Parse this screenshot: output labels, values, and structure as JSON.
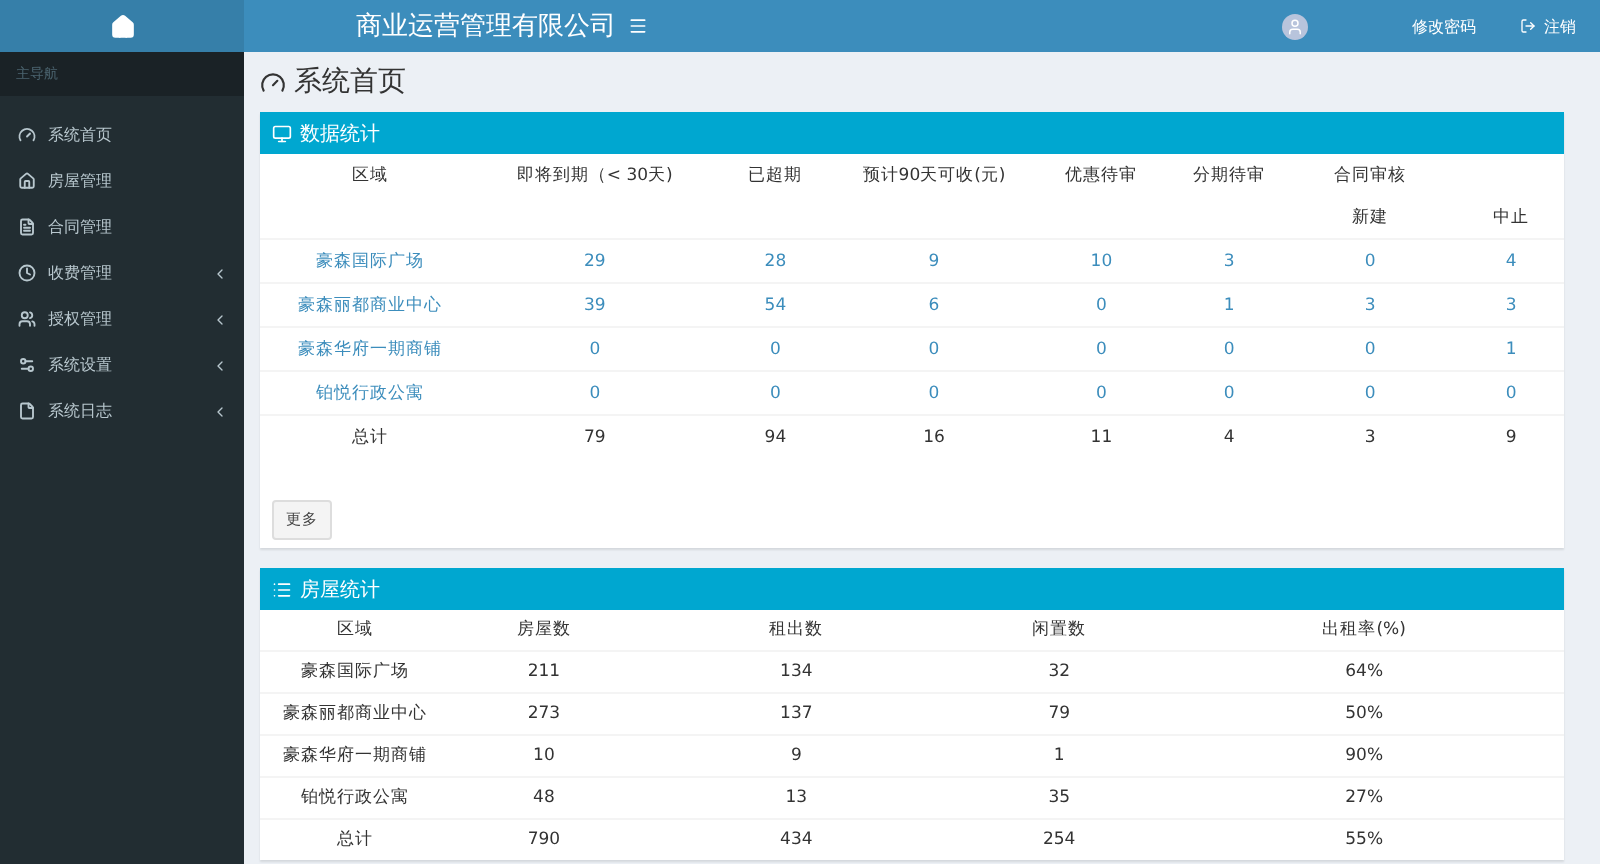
{
  "header": {
    "title": "商业运营管理有限公司",
    "password_link": "修改密码",
    "logout_link": "注销"
  },
  "sidebar": {
    "section": "主导航",
    "items": [
      {
        "label": "系统首页",
        "has_submenu": false
      },
      {
        "label": "房屋管理",
        "has_submenu": false
      },
      {
        "label": "合同管理",
        "has_submenu": false
      },
      {
        "label": "收费管理",
        "has_submenu": true
      },
      {
        "label": "授权管理",
        "has_submenu": true
      },
      {
        "label": "系统设置",
        "has_submenu": true
      },
      {
        "label": "系统日志",
        "has_submenu": true
      }
    ]
  },
  "page_title": "系统首页",
  "data_panel": {
    "title": "数据统计",
    "columns": [
      "区域",
      "即将到期（< 30天)",
      "已超期",
      "预计90天可收(元)",
      "优惠待审",
      "分期待审",
      "合同审核",
      ""
    ],
    "subcolumns": [
      "",
      "",
      "",
      "",
      "",
      "",
      "新建",
      "中止"
    ],
    "rows": [
      {
        "kind": "link",
        "cells": [
          "豪森国际广场",
          "29",
          "28",
          "9",
          "10",
          "3",
          "0",
          "4"
        ]
      },
      {
        "kind": "link",
        "cells": [
          "豪森丽都商业中心",
          "39",
          "54",
          "6",
          "0",
          "1",
          "3",
          "3"
        ]
      },
      {
        "kind": "link",
        "cells": [
          "豪森华府一期商铺",
          "0",
          "0",
          "0",
          "0",
          "0",
          "0",
          "1"
        ]
      },
      {
        "kind": "link",
        "cells": [
          "铂悦行政公寓",
          "0",
          "0",
          "0",
          "0",
          "0",
          "0",
          "0"
        ]
      },
      {
        "kind": "total",
        "cells": [
          "总计",
          "79",
          "94",
          "16",
          "11",
          "4",
          "3",
          "9"
        ]
      }
    ],
    "more_button": "更多"
  },
  "house_panel": {
    "title": "房屋统计",
    "columns": [
      "区域",
      "房屋数",
      "租出数",
      "闲置数",
      "出租率(%)"
    ],
    "rows": [
      {
        "cells": [
          "豪森国际广场",
          "211",
          "134",
          "32",
          "64%"
        ]
      },
      {
        "cells": [
          "豪森丽都商业中心",
          "273",
          "137",
          "79",
          "50%"
        ]
      },
      {
        "cells": [
          "豪森华府一期商铺",
          "10",
          "9",
          "1",
          "90%"
        ]
      },
      {
        "cells": [
          "铂悦行政公寓",
          "48",
          "13",
          "35",
          "27%"
        ]
      },
      {
        "cells": [
          "总计",
          "790",
          "434",
          "254",
          "55%"
        ]
      }
    ]
  }
}
